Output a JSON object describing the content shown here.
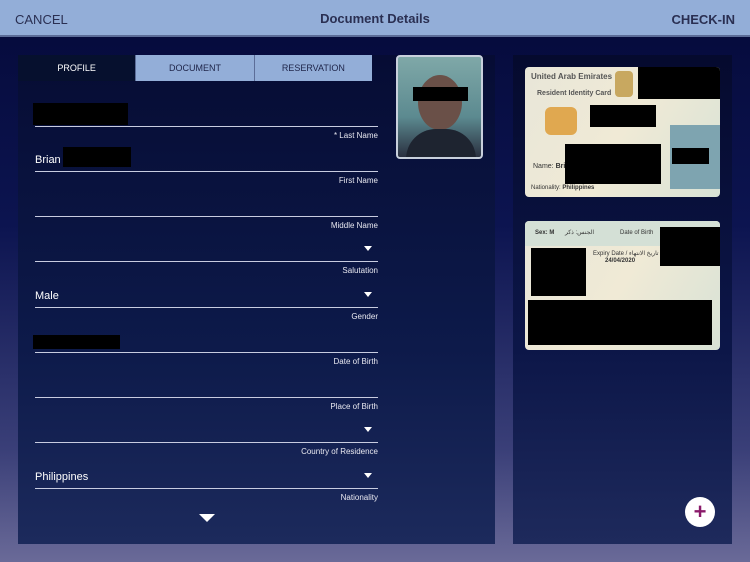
{
  "header": {
    "cancel": "CANCEL",
    "title": "Document Details",
    "checkin": "CHECK-IN"
  },
  "tabs": [
    "PROFILE",
    "DOCUMENT",
    "RESERVATION"
  ],
  "fields": [
    {
      "label": "* Last Name",
      "value": ""
    },
    {
      "label": "First Name",
      "value": "Brian"
    },
    {
      "label": "Middle Name",
      "value": ""
    },
    {
      "label": "Salutation",
      "value": ""
    },
    {
      "label": "Gender",
      "value": "Male"
    },
    {
      "label": "Date of Birth",
      "value": ""
    },
    {
      "label": "Place of Birth",
      "value": ""
    },
    {
      "label": "Country of Residence",
      "value": ""
    },
    {
      "label": "Nationality",
      "value": "Philippines"
    }
  ],
  "card_front": {
    "country": "United Arab Emirates",
    "type": "Resident Identity Card",
    "name_label": "Name:",
    "name": "Brian",
    "nationality_label": "Nationality:",
    "nationality": "Philippines"
  },
  "card_back": {
    "sex": "Sex: M",
    "sex_ar": "الجنس: ذكر",
    "dob_label": "Date of Birth",
    "expiry_label": "Expiry Date / تاريخ الانتهاء",
    "expiry": "24/04/2020"
  },
  "add_button": "+"
}
